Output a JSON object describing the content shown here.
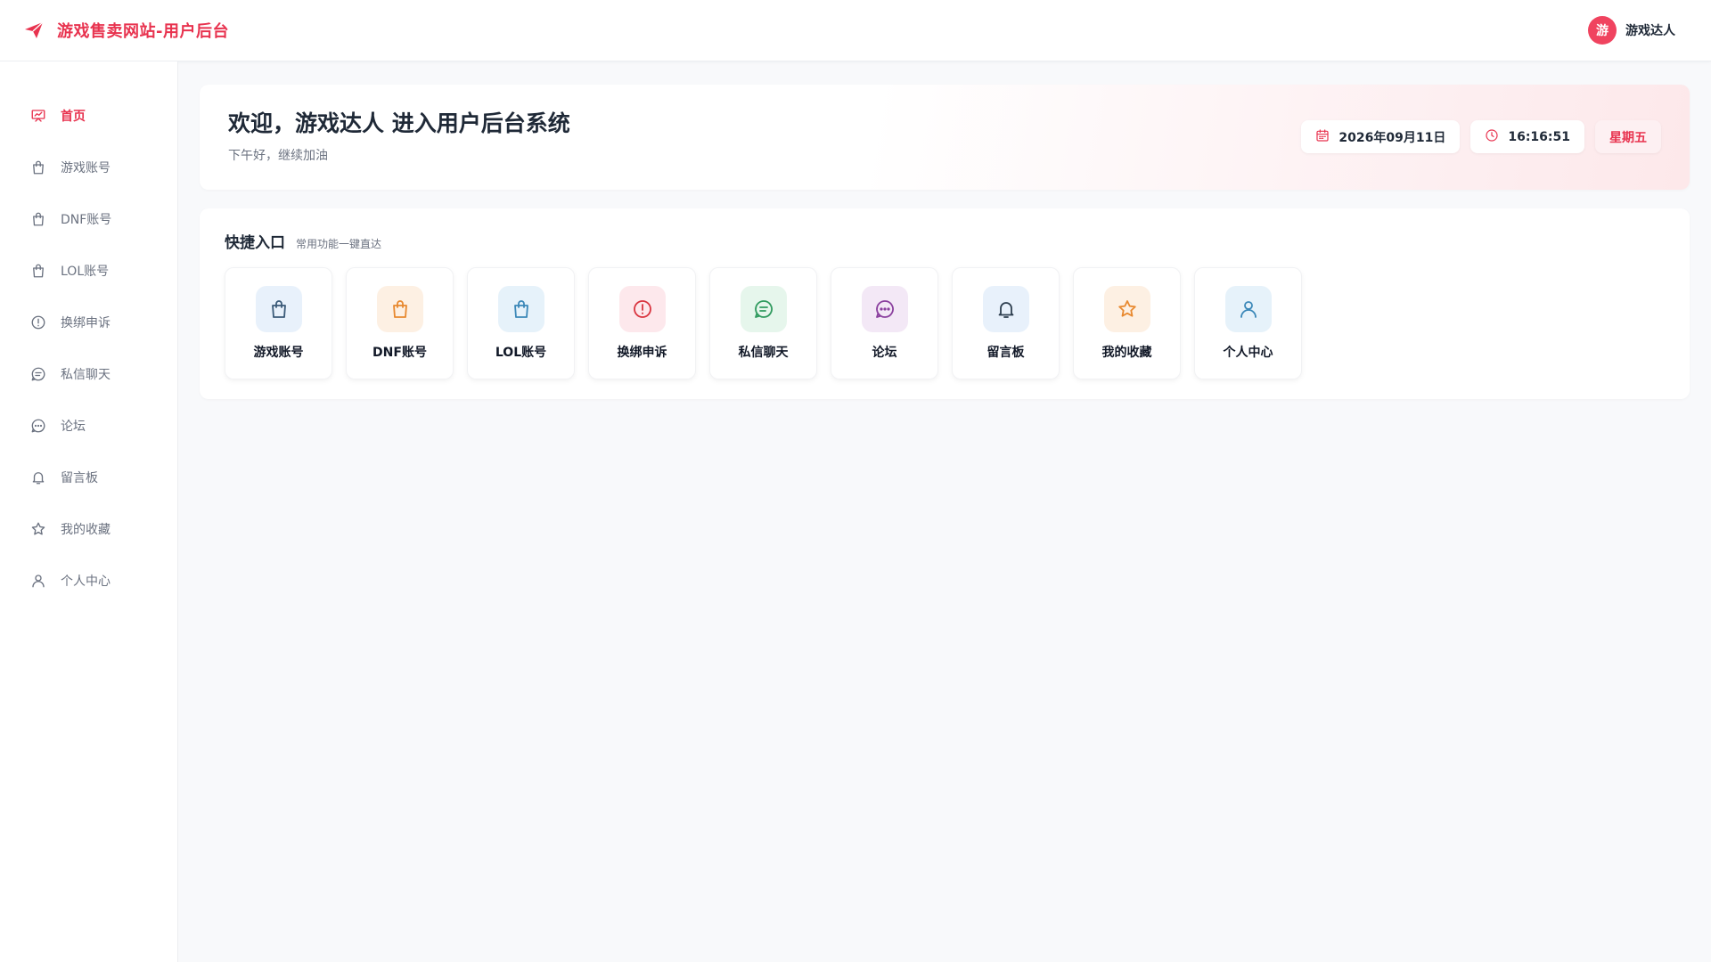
{
  "header": {
    "brand_title": "游戏售卖网站-用户后台",
    "brand_icon": "paper-plane-icon",
    "user": {
      "avatar_text": "游",
      "name": "游戏达人"
    }
  },
  "sidebar": {
    "items": [
      {
        "label": "首页",
        "icon": "presentation-icon",
        "active": true
      },
      {
        "label": "游戏账号",
        "icon": "shopping-bag-icon"
      },
      {
        "label": "DNF账号",
        "icon": "shopping-bag-icon"
      },
      {
        "label": "LOL账号",
        "icon": "shopping-bag-icon"
      },
      {
        "label": "换绑申诉",
        "icon": "alert-circle-icon"
      },
      {
        "label": "私信聊天",
        "icon": "message-icon"
      },
      {
        "label": "论坛",
        "icon": "chat-bubble-icon"
      },
      {
        "label": "留言板",
        "icon": "bell-icon"
      },
      {
        "label": "我的收藏",
        "icon": "star-icon"
      },
      {
        "label": "个人中心",
        "icon": "user-icon"
      }
    ]
  },
  "welcome": {
    "title": "欢迎，游戏达人 进入用户后台系统",
    "subtitle": "下午好，继续加油",
    "date": "2026年09月11日",
    "time": "16:16:51",
    "weekday": "星期五"
  },
  "quick": {
    "title": "快捷入口",
    "subtitle": "常用功能一键直达",
    "cards": [
      {
        "label": "游戏账号",
        "icon": "shopping-bag-icon",
        "color": "#3a5a78",
        "bg": "#e8f1fb"
      },
      {
        "label": "DNF账号",
        "icon": "shopping-bag-icon",
        "color": "#e8892f",
        "bg": "#fdf0e3"
      },
      {
        "label": "LOL账号",
        "icon": "shopping-bag-icon",
        "color": "#3b88b8",
        "bg": "#e6f2fa"
      },
      {
        "label": "换绑申诉",
        "icon": "alert-circle-icon",
        "color": "#d9343f",
        "bg": "#fde8ec"
      },
      {
        "label": "私信聊天",
        "icon": "message-icon",
        "color": "#2f9a5e",
        "bg": "#e6f6ec"
      },
      {
        "label": "论坛",
        "icon": "chat-bubble-icon",
        "color": "#8a3f9e",
        "bg": "#f3e8f6"
      },
      {
        "label": "留言板",
        "icon": "bell-icon",
        "color": "#2d3e4e",
        "bg": "#e8f1fb"
      },
      {
        "label": "我的收藏",
        "icon": "star-icon",
        "color": "#e8892f",
        "bg": "#fdf0e3"
      },
      {
        "label": "个人中心",
        "icon": "user-icon",
        "color": "#3b88b8",
        "bg": "#e6f2fa"
      }
    ]
  },
  "colors": {
    "accent": "#e8334f",
    "page_bg": "#f8f9fb"
  }
}
